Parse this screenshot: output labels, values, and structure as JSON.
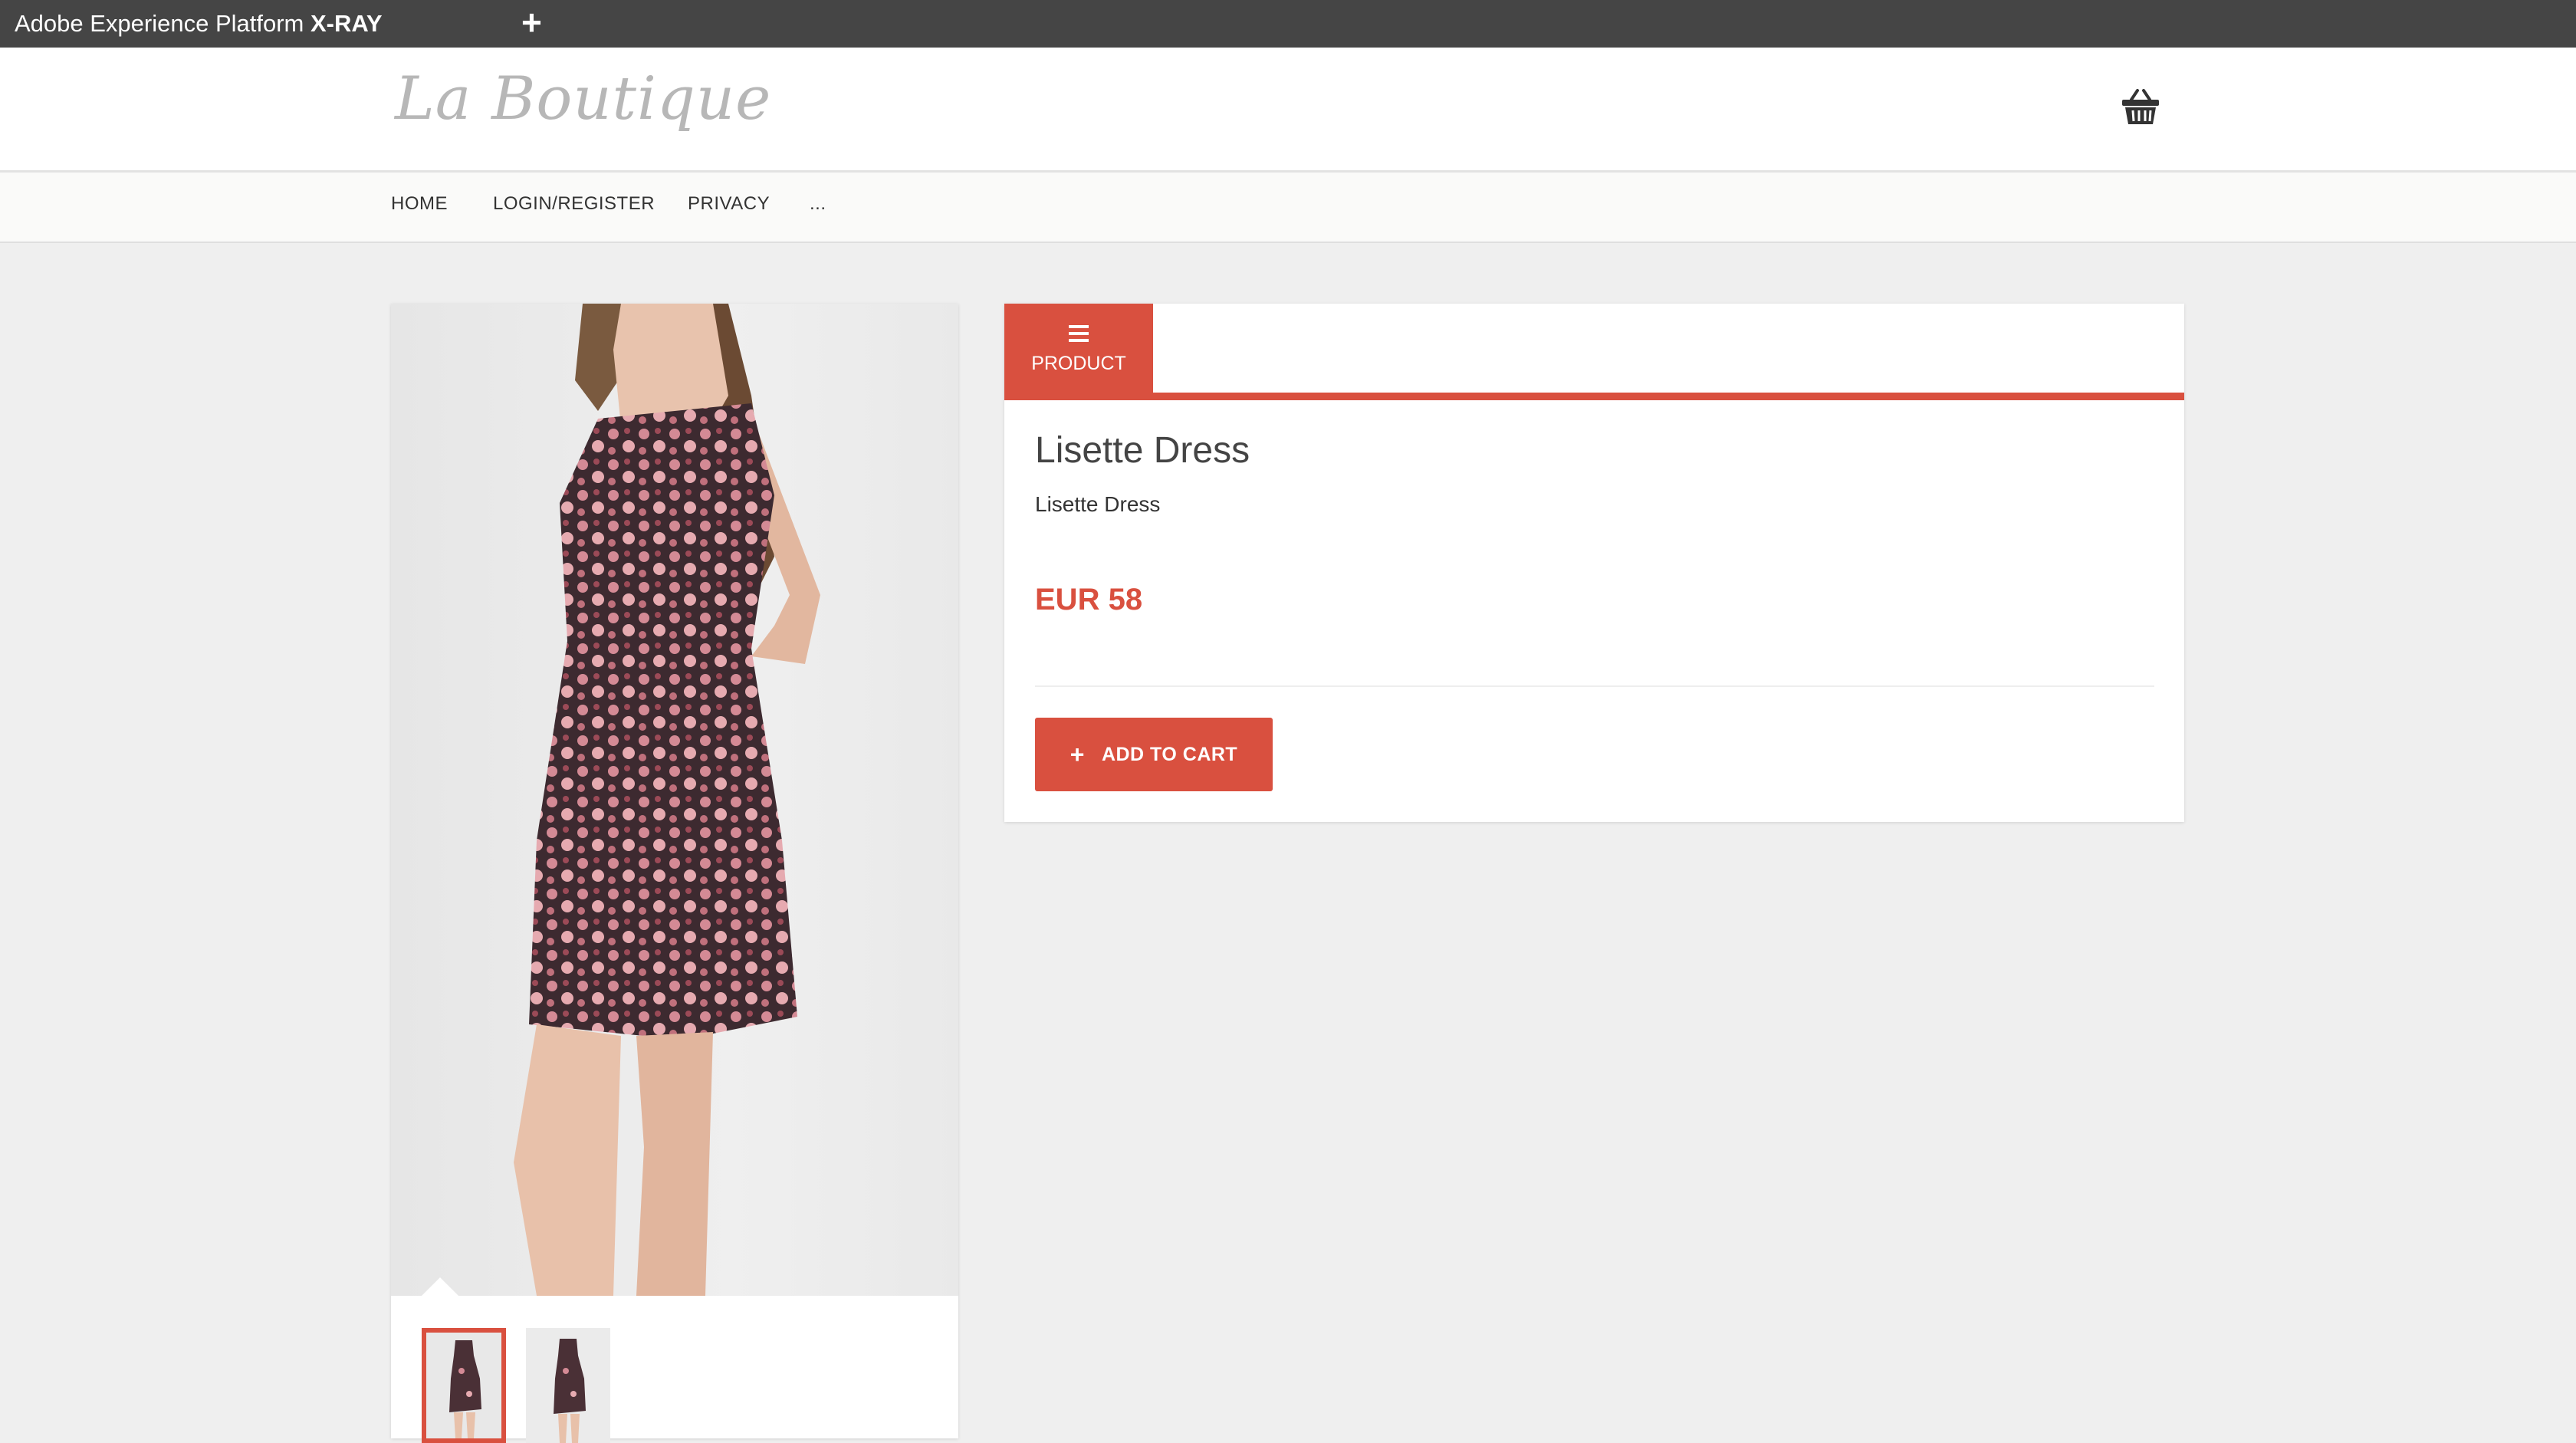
{
  "xray": {
    "title_prefix": "Adobe Experience Platform",
    "title_bold": "X-RAY",
    "add_icon": "+"
  },
  "header": {
    "logo": "La Boutique",
    "cart_icon": "shopping-basket-icon"
  },
  "nav": {
    "items": [
      {
        "label": "HOME"
      },
      {
        "label": "LOGIN/REGISTER"
      },
      {
        "label": "PRIVACY"
      },
      {
        "label": "..."
      }
    ]
  },
  "product": {
    "tab_label": "PRODUCT",
    "tab_icon": "hamburger-menu-icon",
    "title": "Lisette Dress",
    "subtitle": "Lisette Dress",
    "price": "EUR 58",
    "add_to_cart_label": "ADD TO CART",
    "add_icon": "+"
  },
  "colors": {
    "accent": "#d9503f",
    "topbar": "#454545",
    "page_bg": "#efefef"
  }
}
